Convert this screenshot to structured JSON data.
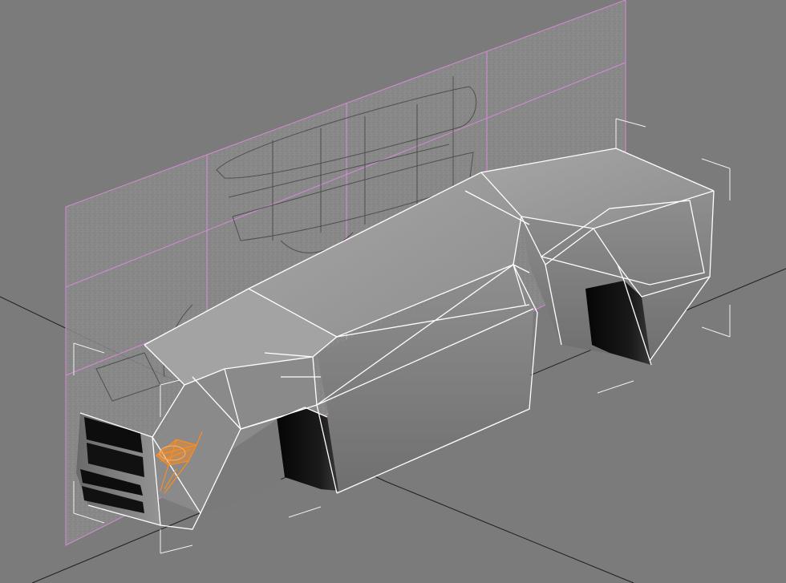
{
  "viewport": {
    "background_color": "#7b7b7b",
    "selection_color": "#ff8c1a",
    "wire_color": "#ffffff",
    "blueprint_border_color": "#d68ad6",
    "grid_axis_color": "#1a1a1a"
  },
  "scene": {
    "objects": [
      {
        "name": "car-body-mesh"
      },
      {
        "name": "blueprint-reference-plane"
      },
      {
        "name": "selected-headlight-polygons"
      },
      {
        "name": "selection-bounding-box"
      }
    ]
  }
}
